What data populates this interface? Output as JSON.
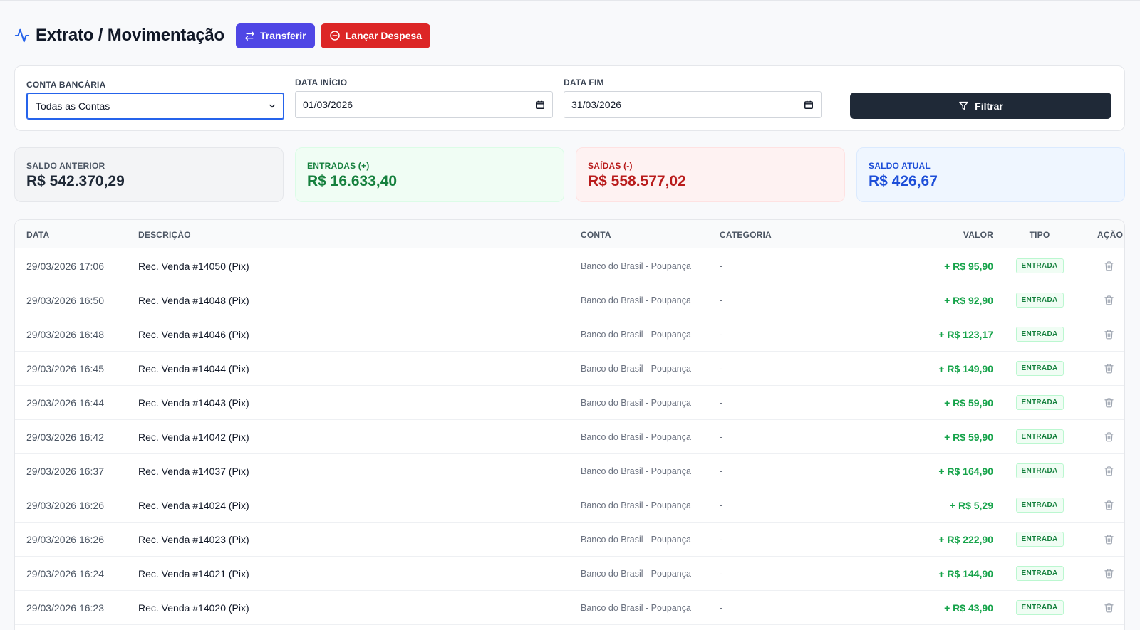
{
  "header": {
    "title": "Extrato / Movimentação",
    "transfer_label": "Transferir",
    "expense_label": "Lançar Despesa"
  },
  "filters": {
    "account_label": "CONTA BANCÁRIA",
    "account_value": "Todas as Contas",
    "start_label": "DATA INÍCIO",
    "start_value": "01/03/2026",
    "end_label": "DATA FIM",
    "end_value": "31/03/2026",
    "filter_label": "Filtrar"
  },
  "summary": {
    "previous": {
      "label": "SALDO ANTERIOR",
      "value": "R$ 542.370,29"
    },
    "income": {
      "label": "ENTRADAS (+)",
      "value": "R$ 16.633,40"
    },
    "outgoing": {
      "label": "SAÍDAS (-)",
      "value": "R$ 558.577,02"
    },
    "current": {
      "label": "SALDO ATUAL",
      "value": "R$ 426,67"
    }
  },
  "table": {
    "headers": {
      "date": "DATA",
      "description": "DESCRIÇÃO",
      "account": "CONTA",
      "category": "CATEGORIA",
      "value": "VALOR",
      "type": "TIPO",
      "action": "AÇÃO"
    },
    "rows": [
      {
        "date": "29/03/2026 17:06",
        "description": "Rec. Venda #14050 (Pix)",
        "account": "Banco do Brasil - Poupança",
        "category": "-",
        "value": "+ R$ 95,90",
        "type": "ENTRADA"
      },
      {
        "date": "29/03/2026 16:50",
        "description": "Rec. Venda #14048 (Pix)",
        "account": "Banco do Brasil - Poupança",
        "category": "-",
        "value": "+ R$ 92,90",
        "type": "ENTRADA"
      },
      {
        "date": "29/03/2026 16:48",
        "description": "Rec. Venda #14046 (Pix)",
        "account": "Banco do Brasil - Poupança",
        "category": "-",
        "value": "+ R$ 123,17",
        "type": "ENTRADA"
      },
      {
        "date": "29/03/2026 16:45",
        "description": "Rec. Venda #14044 (Pix)",
        "account": "Banco do Brasil - Poupança",
        "category": "-",
        "value": "+ R$ 149,90",
        "type": "ENTRADA"
      },
      {
        "date": "29/03/2026 16:44",
        "description": "Rec. Venda #14043 (Pix)",
        "account": "Banco do Brasil - Poupança",
        "category": "-",
        "value": "+ R$ 59,90",
        "type": "ENTRADA"
      },
      {
        "date": "29/03/2026 16:42",
        "description": "Rec. Venda #14042 (Pix)",
        "account": "Banco do Brasil - Poupança",
        "category": "-",
        "value": "+ R$ 59,90",
        "type": "ENTRADA"
      },
      {
        "date": "29/03/2026 16:37",
        "description": "Rec. Venda #14037 (Pix)",
        "account": "Banco do Brasil - Poupança",
        "category": "-",
        "value": "+ R$ 164,90",
        "type": "ENTRADA"
      },
      {
        "date": "29/03/2026 16:26",
        "description": "Rec. Venda #14024 (Pix)",
        "account": "Banco do Brasil - Poupança",
        "category": "-",
        "value": "+ R$ 5,29",
        "type": "ENTRADA"
      },
      {
        "date": "29/03/2026 16:26",
        "description": "Rec. Venda #14023 (Pix)",
        "account": "Banco do Brasil - Poupança",
        "category": "-",
        "value": "+ R$ 222,90",
        "type": "ENTRADA"
      },
      {
        "date": "29/03/2026 16:24",
        "description": "Rec. Venda #14021 (Pix)",
        "account": "Banco do Brasil - Poupança",
        "category": "-",
        "value": "+ R$ 144,90",
        "type": "ENTRADA"
      },
      {
        "date": "29/03/2026 16:23",
        "description": "Rec. Venda #14020 (Pix)",
        "account": "Banco do Brasil - Poupança",
        "category": "-",
        "value": "+ R$ 43,90",
        "type": "ENTRADA"
      }
    ]
  }
}
